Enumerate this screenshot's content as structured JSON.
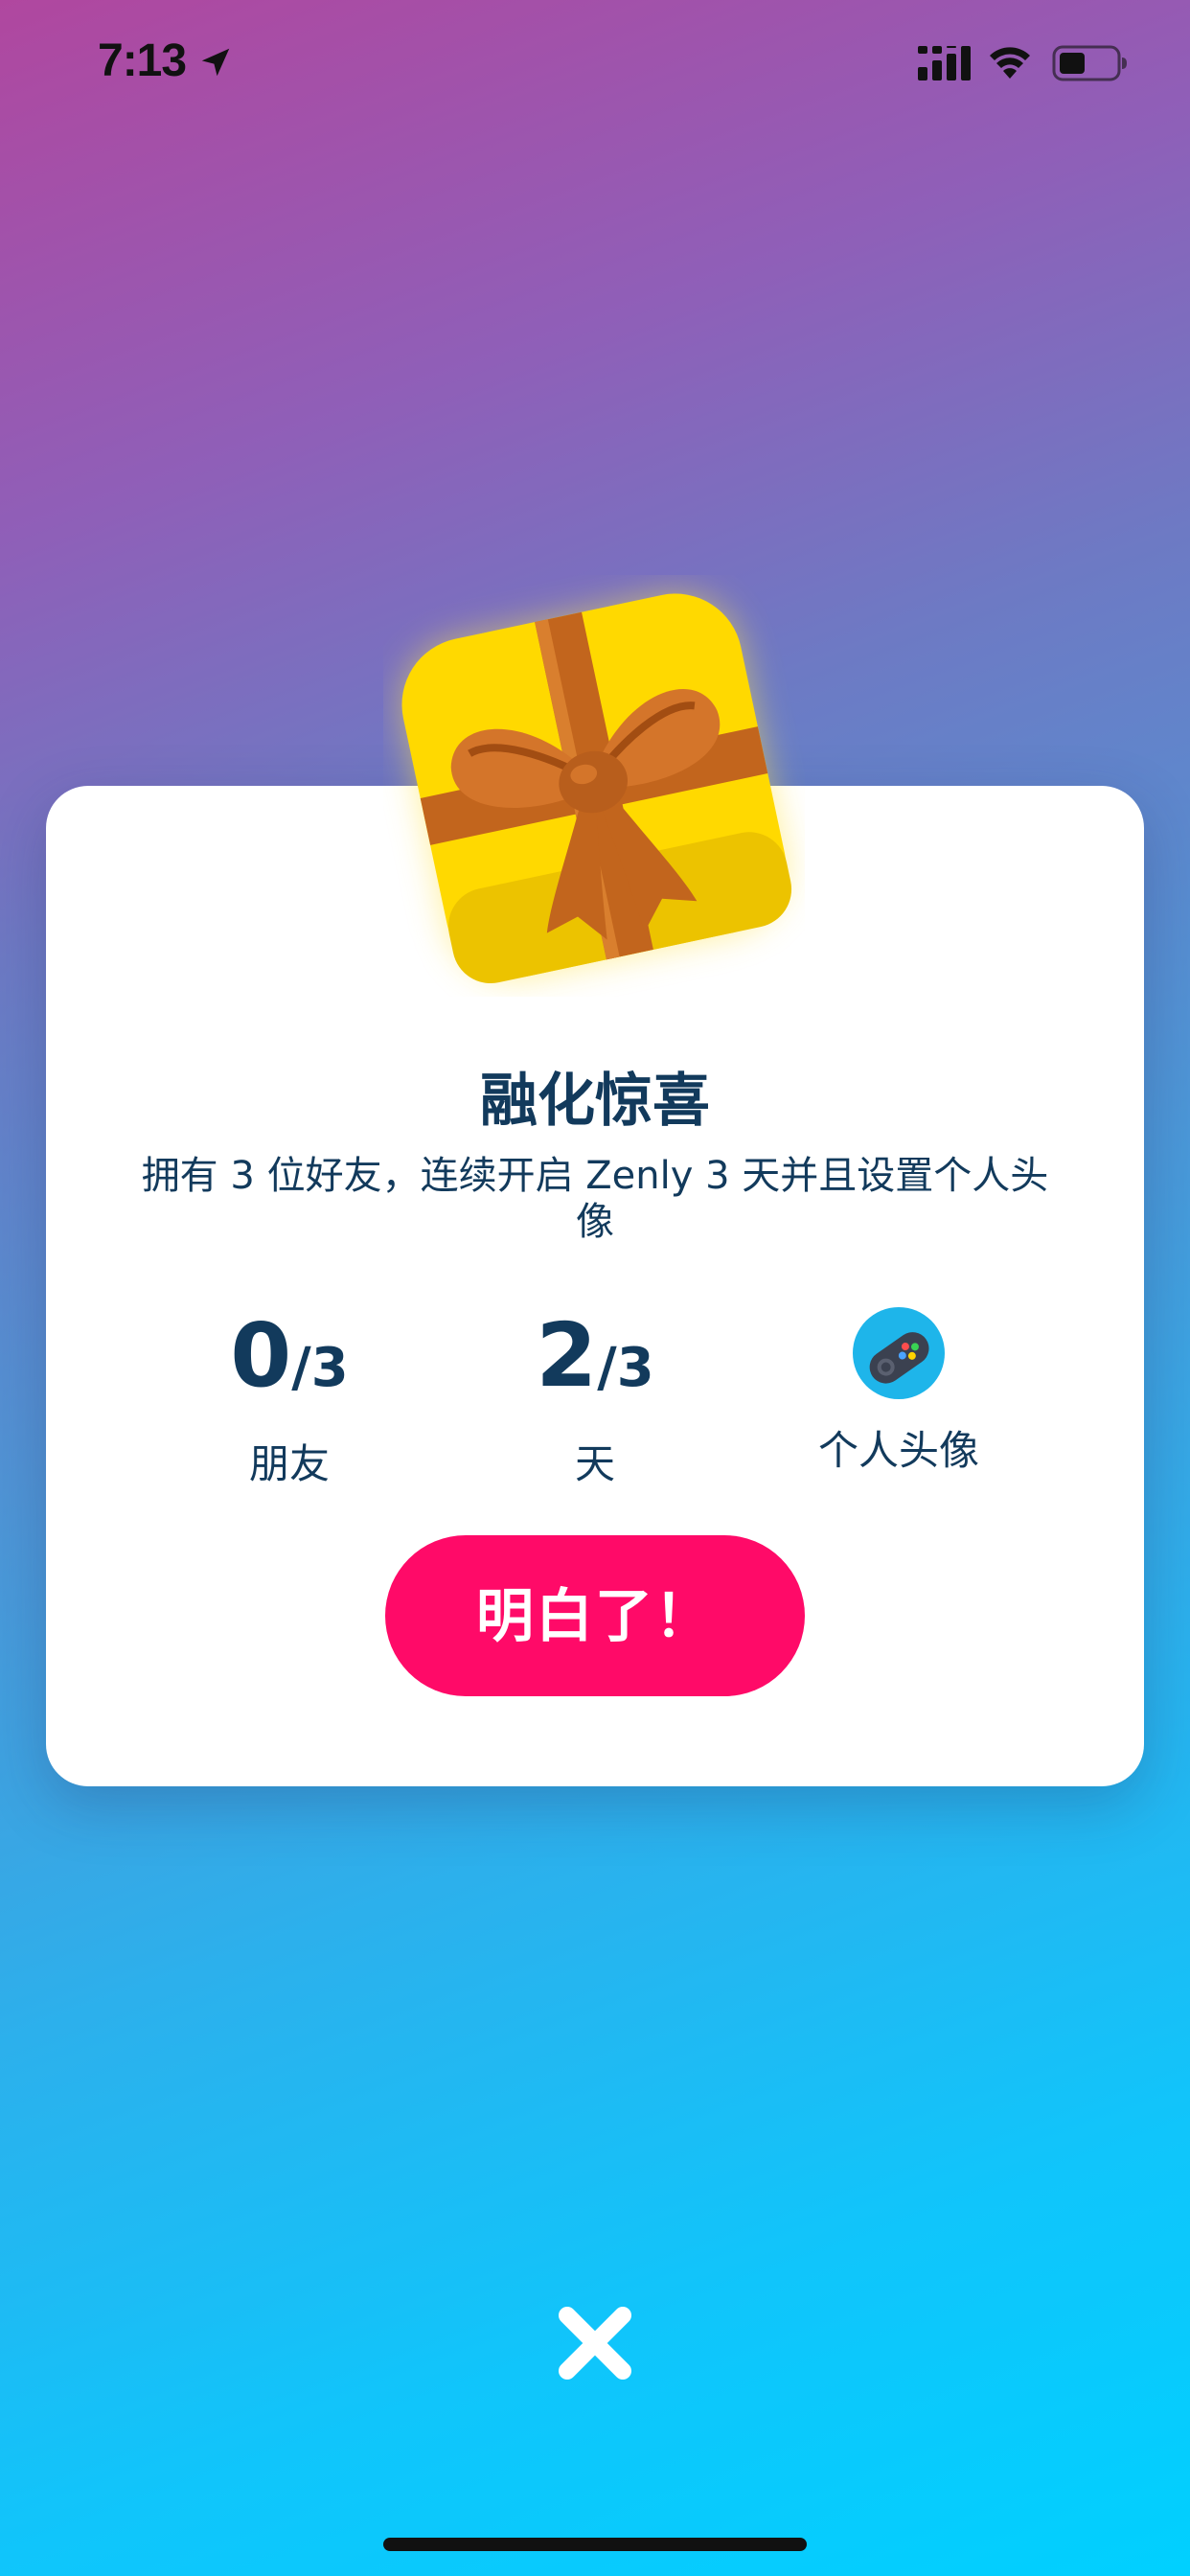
{
  "status_bar": {
    "time": "7:13",
    "icons": [
      "location-arrow-icon",
      "cellular-signal-icon",
      "wifi-icon",
      "battery-icon"
    ]
  },
  "card": {
    "title": "融化惊喜",
    "description": "拥有 3 位好友，连续开启 Zenly 3 天并且设置个人头像",
    "stats": [
      {
        "value": "0",
        "total": "/3",
        "label": "朋友"
      },
      {
        "value": "2",
        "total": "/3",
        "label": "天"
      },
      {
        "icon": "game-controller-avatar-icon",
        "label": "个人头像"
      }
    ],
    "button_label": "明白了！"
  },
  "colors": {
    "accent": "#ff0a68",
    "text": "#123a5c",
    "gift_yellow": "#ffd900",
    "ribbon": "#c2651d"
  },
  "close_icon": "close-x-icon"
}
